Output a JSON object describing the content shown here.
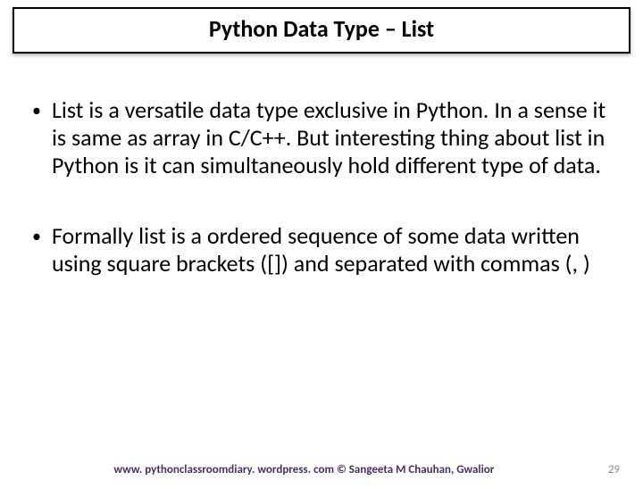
{
  "title": "Python Data Type – List",
  "bullets": [
    "List is a versatile data type exclusive in Python. In a sense it is same as array in C/C++. But interesting thing about list in Python is it can simultaneously hold different type of data.",
    "Formally list is a ordered sequence of some data written using square brackets ([]) and separated with commas (, )"
  ],
  "footer": {
    "credit": "www. pythonclassroomdiary. wordpress. com ©  Sangeeta M Chauhan, Gwalior",
    "page": "29"
  }
}
